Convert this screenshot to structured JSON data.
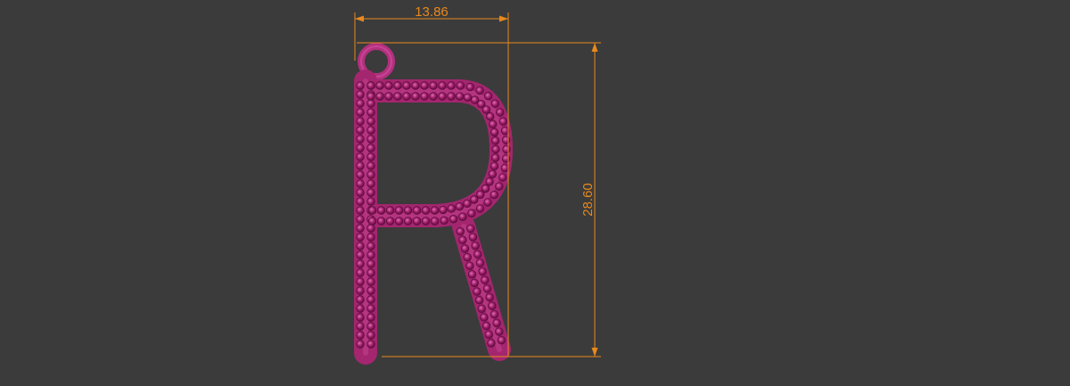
{
  "viewport": {
    "background_color": "#3b3b3b",
    "dimension_color": "#e8891c",
    "model_color": "#b3307f"
  },
  "model": {
    "name": "letter-r-pendant-with-bail",
    "letter": "R"
  },
  "dimensions": {
    "width_label": "13.86",
    "height_label": "28.60"
  }
}
